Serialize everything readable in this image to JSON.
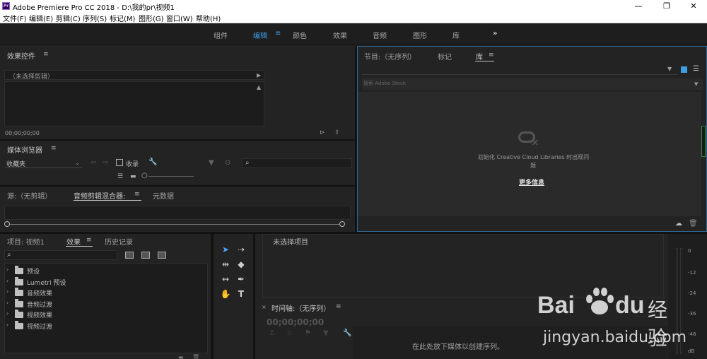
{
  "window": {
    "app_logo": "Pr",
    "title": "Adobe Premiere Pro CC 2018 - D:\\我的pr\\视频1",
    "minimize": "—",
    "restore": "❐",
    "close": "✕"
  },
  "menu": [
    "文件(F)",
    "编辑(E)",
    "剪辑(C)",
    "序列(S)",
    "标记(M)",
    "图形(G)",
    "窗口(W)",
    "帮助(H)"
  ],
  "workspaces": {
    "items": [
      "组件",
      "编辑",
      "颜色",
      "效果",
      "音频",
      "图形",
      "库"
    ],
    "active": "编辑",
    "more": "»"
  },
  "effect_controls": {
    "title": "效果控件",
    "clip_label": "（未选择剪辑）",
    "timecode": "00;00;00;00"
  },
  "media_browser": {
    "title": "媒体浏览器",
    "dropdown_value": "收藏夹",
    "favorites_label": "收录"
  },
  "source_tabs": {
    "source": "源:（无剪辑）",
    "audio_mixer": "音频剪辑混合器:",
    "metadata": "元数据"
  },
  "program_tabs": {
    "program": "节目:（无序列）",
    "markers": "标记",
    "libraries": "库"
  },
  "libraries": {
    "search_placeholder": "搜索 Adobe Stock",
    "message_line1": "初始化 Creative Cloud Libraries 时出现问",
    "message_line2": "题",
    "more_info": "更多信息"
  },
  "project": {
    "tab_project": "项目: 视频1",
    "tab_effects": "效果",
    "tab_history": "历史记录",
    "items": [
      "预设",
      "Lumetri 预设",
      "音频效果",
      "音频过渡",
      "视频效果",
      "视频过渡"
    ]
  },
  "tools_icons": [
    "selection-tool-icon",
    "track-select-tool-icon",
    "ripple-edit-tool-icon",
    "razor-tool-icon",
    "slip-tool-icon",
    "pen-tool-icon",
    "hand-tool-icon",
    "type-tool-icon"
  ],
  "sequence": {
    "no_selection": "未选择项目",
    "timeline_title": "时间轴:（无序列）",
    "timecode": "00;00;00;00",
    "drop_hint": "在此处放下媒体以创建序列。"
  },
  "audio_meter": {
    "labels": [
      "0",
      "-12",
      "-24",
      "-36",
      "-48",
      "dB"
    ]
  },
  "watermark": {
    "brand": "Bai",
    "brand2": "du",
    "cn": "经验",
    "url": "jingyan.baidu.com"
  }
}
